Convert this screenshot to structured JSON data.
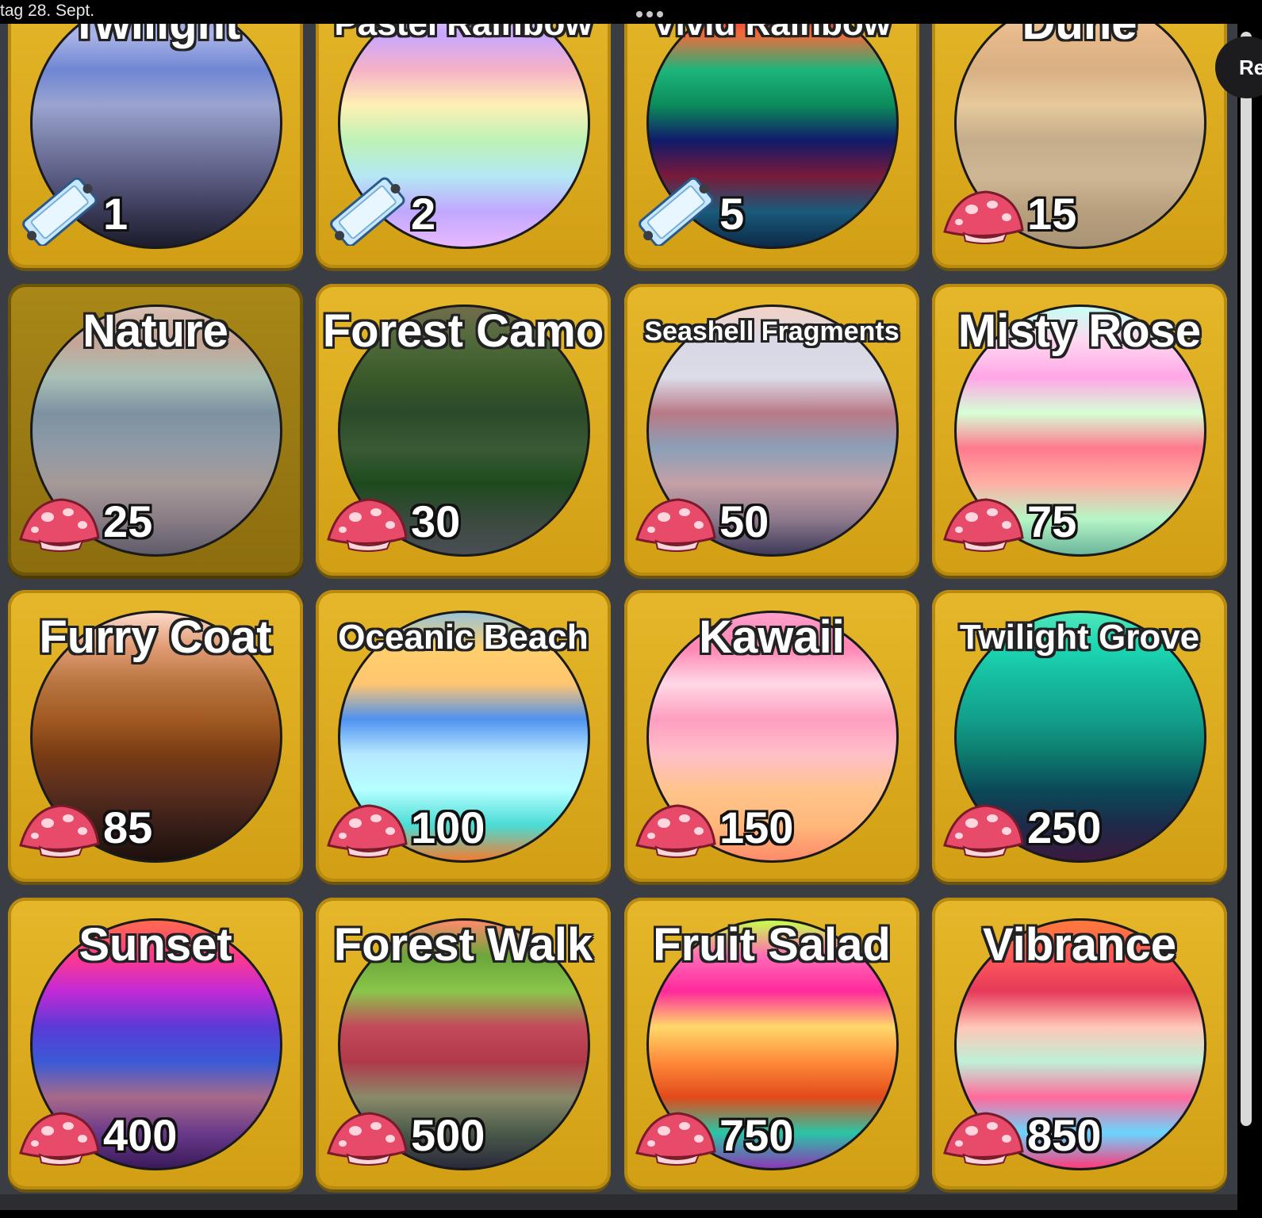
{
  "status": {
    "time_text": "tag 28. Sept."
  },
  "side_button": {
    "label": "Re"
  },
  "colors": {
    "card": "#e0ae1f",
    "panel": "#3a3d43"
  },
  "items": [
    {
      "name": "Twilight",
      "price": "1",
      "currency": "ticket-icon",
      "selected": false,
      "gradient": [
        "#8a9bd6",
        "#aab4e6",
        "#6f86d3",
        "#9aa4cf",
        "#7a7fa8",
        "#5c5d84",
        "#3a3a58",
        "#1c1c2c"
      ]
    },
    {
      "name": "Pastel Rainbow",
      "price": "2",
      "currency": "ticket-icon",
      "selected": false,
      "gradient": [
        "#f3d8ff",
        "#c8a6ff",
        "#f6b2c6",
        "#fff0b4",
        "#bdf2b6",
        "#b4e8f4",
        "#c0a8ff",
        "#e8b8ff"
      ]
    },
    {
      "name": "Vivid Rainbow",
      "price": "5",
      "currency": "ticket-icon",
      "selected": false,
      "gradient": [
        "#e51d3c",
        "#f26a3a",
        "#1db57a",
        "#0c8c5a",
        "#101a6a",
        "#7a1a3a",
        "#1a5a7a",
        "#0c2a4a"
      ]
    },
    {
      "name": "Dune",
      "price": "15",
      "currency": "mushroom-icon",
      "selected": false,
      "gradient": [
        "#f5cfa0",
        "#e7b98a",
        "#d8b083",
        "#e6c99c",
        "#c4ad8a",
        "#cfb795",
        "#b89f7e",
        "#a89475"
      ]
    },
    {
      "name": "Nature",
      "price": "25",
      "currency": "mushroom-icon",
      "selected": true,
      "gradient": [
        "#d9c0b5",
        "#c6a596",
        "#a8c0b6",
        "#7d92a2",
        "#8f9aa6",
        "#a59a98",
        "#8a7d86",
        "#5f5c6a"
      ]
    },
    {
      "name": "Forest Camo",
      "price": "30",
      "currency": "mushroom-icon",
      "selected": false,
      "gradient": [
        "#726c4c",
        "#4f6a3a",
        "#3a5a2a",
        "#2b4a2a",
        "#3a5a34",
        "#1e4a1e",
        "#3a4a3e",
        "#4a4e54"
      ]
    },
    {
      "name": "Seashell Fragments",
      "price": "50",
      "currency": "mushroom-icon",
      "selected": false,
      "gradient": [
        "#f2d2c6",
        "#d8d8e6",
        "#dcdce8",
        "#b87a86",
        "#8aa0b8",
        "#c6a0a6",
        "#8e7a8c",
        "#3e3a5a"
      ]
    },
    {
      "name": "Misty Rose",
      "price": "75",
      "currency": "mushroom-icon",
      "selected": false,
      "gradient": [
        "#c7fff4",
        "#ffd6f0",
        "#ffa6e6",
        "#d6ffd6",
        "#ff7a8c",
        "#ffb0a4",
        "#b6f6c6",
        "#6cb69c"
      ]
    },
    {
      "name": "Furry Coat",
      "price": "85",
      "currency": "mushroom-icon",
      "selected": false,
      "gradient": [
        "#fbd8c8",
        "#e09a72",
        "#b8743f",
        "#a15a22",
        "#7a3c14",
        "#5a2e1e",
        "#3a1e18",
        "#1c100c"
      ]
    },
    {
      "name": "Oceanic Beach",
      "price": "100",
      "currency": "mushroom-icon",
      "selected": false,
      "gradient": [
        "#9ac3d6",
        "#ffcf6c",
        "#ffc670",
        "#4f92f0",
        "#b6e8ff",
        "#b6ffff",
        "#4adcd6",
        "#f27d30"
      ]
    },
    {
      "name": "Kawaii",
      "price": "150",
      "currency": "mushroom-icon",
      "selected": false,
      "gradient": [
        "#ff9ecb",
        "#ff86b3",
        "#ffd8e6",
        "#ff9ec0",
        "#ffbfc8",
        "#ffc48c",
        "#ffb87a",
        "#ff8a6a"
      ]
    },
    {
      "name": "Twilight Grove",
      "price": "250",
      "currency": "mushroom-icon",
      "selected": false,
      "gradient": [
        "#4fe6ba",
        "#1bd6b2",
        "#15b89c",
        "#12a08a",
        "#0d7a6e",
        "#0a4a58",
        "#1e2a4a",
        "#3a1a3e"
      ]
    },
    {
      "name": "Sunset",
      "price": "400",
      "currency": "mushroom-icon",
      "selected": false,
      "gradient": [
        "#ff6a4c",
        "#ff3a8c",
        "#c22ad6",
        "#5a3ad6",
        "#3a5ad6",
        "#a86a8a",
        "#6a3a8a",
        "#3a1a5a"
      ]
    },
    {
      "name": "Forest Walk",
      "price": "500",
      "currency": "mushroom-icon",
      "selected": false,
      "gradient": [
        "#ff8a6c",
        "#6aa63a",
        "#8ac64a",
        "#c24a5a",
        "#b03a4a",
        "#8a8a6a",
        "#4a5a4a",
        "#2a2a3a"
      ]
    },
    {
      "name": "Fruit Salad",
      "price": "750",
      "currency": "mushroom-icon",
      "selected": false,
      "gradient": [
        "#c8ff4a",
        "#ff6ab8",
        "#ff2a9c",
        "#ffd86a",
        "#ff8a3a",
        "#e24a1a",
        "#2ac6a6",
        "#8a3ab6"
      ]
    },
    {
      "name": "Vibrance",
      "price": "850",
      "currency": "mushroom-icon",
      "selected": false,
      "gradient": [
        "#ff7a3a",
        "#ff5a5a",
        "#e63a5a",
        "#ffc6b6",
        "#bff0d6",
        "#ff6a9c",
        "#6ad6ff",
        "#ff3a7a"
      ]
    }
  ]
}
